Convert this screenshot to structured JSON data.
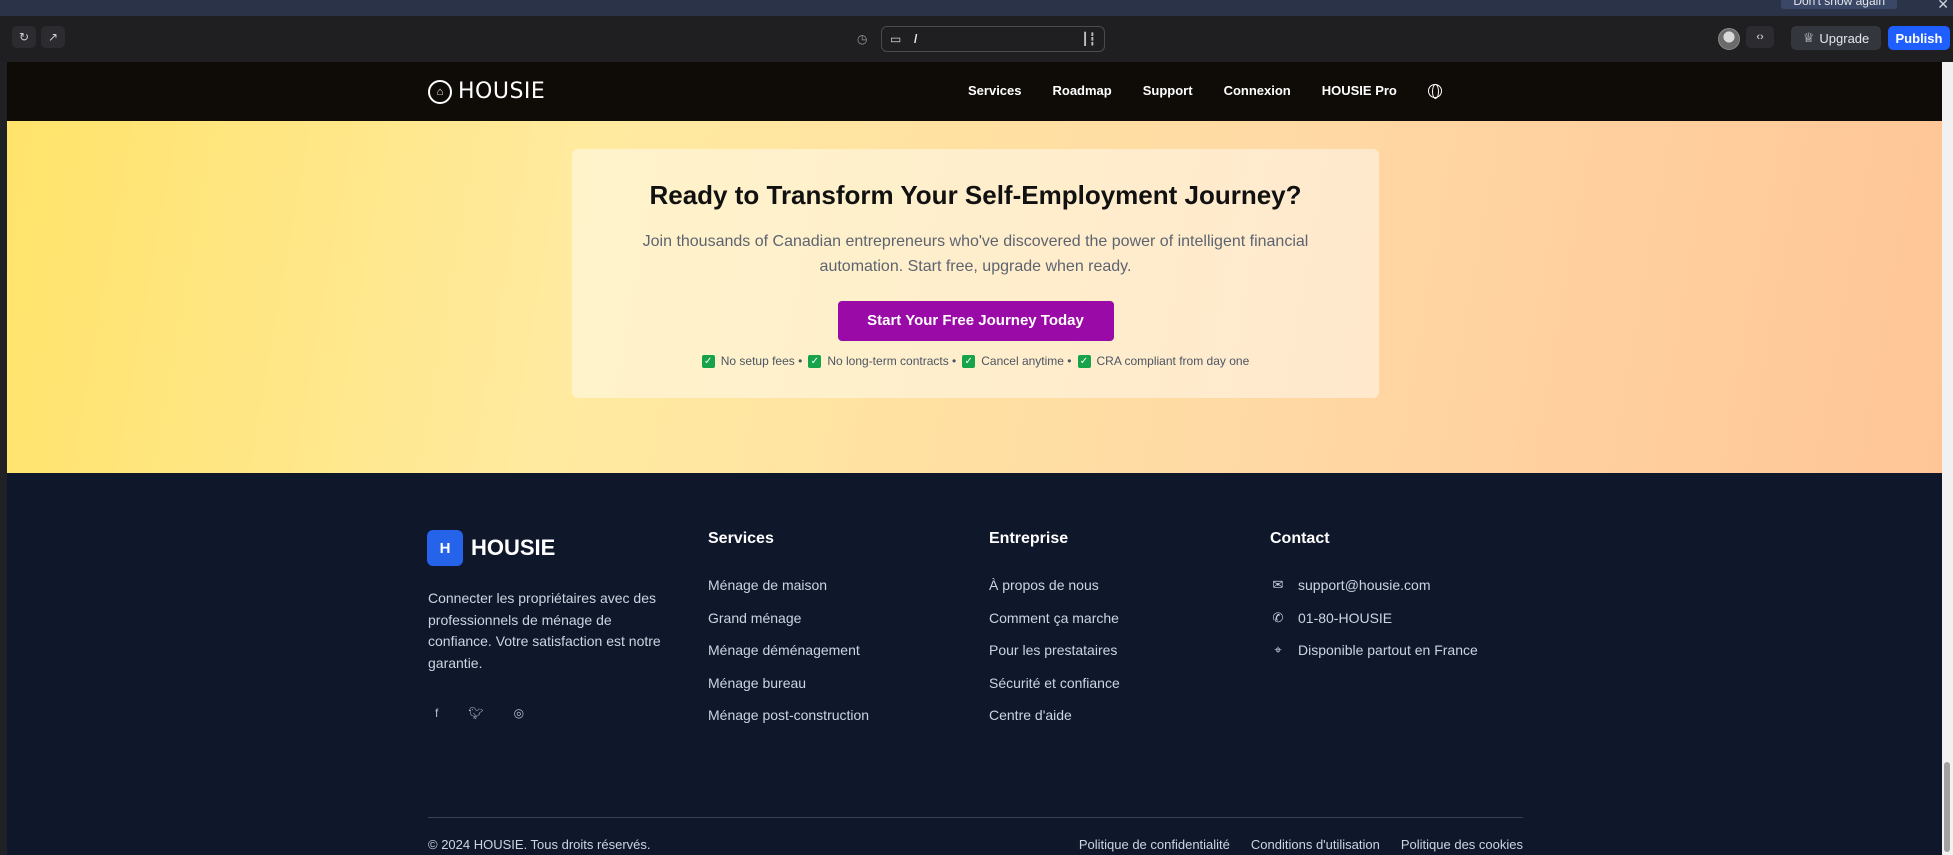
{
  "browser": {
    "notice_button": "Don't show again",
    "url_path": "/",
    "upgrade_label": "Upgrade",
    "publish_label": "Publish"
  },
  "nav": {
    "logo_text": "HOUSIE",
    "links": [
      "Services",
      "Roadmap",
      "Support",
      "Connexion",
      "HOUSIE Pro"
    ]
  },
  "cta_section": {
    "title": "Ready to Transform Your Self-Employment Journey?",
    "subtitle": "Join thousands of Canadian entrepreneurs who've discovered the power of intelligent financial automation. Start free, upgrade when ready.",
    "button": "Start Your Free Journey Today",
    "checks": [
      "No setup fees •",
      "No long-term contracts •",
      "Cancel anytime •",
      "CRA compliant from day one"
    ]
  },
  "footer": {
    "badge": "H",
    "brand": "HOUSIE",
    "description": "Connecter les propriétaires avec des professionnels de ménage de confiance. Votre satisfaction est notre garantie.",
    "services": {
      "title": "Services",
      "items": [
        "Ménage de maison",
        "Grand ménage",
        "Ménage déménagement",
        "Ménage bureau",
        "Ménage post-construction"
      ]
    },
    "company": {
      "title": "Entreprise",
      "items": [
        "À propos de nous",
        "Comment ça marche",
        "Pour les prestataires",
        "Sécurité et confiance",
        "Centre d'aide"
      ]
    },
    "contact": {
      "title": "Contact",
      "email": "support@housie.com",
      "phone": "01-80-HOUSIE",
      "location": "Disponible partout en France"
    },
    "copyright": "© 2024 HOUSIE. Tous droits réservés.",
    "legal": [
      "Politique de confidentialité",
      "Conditions d'utilisation",
      "Politique des cookies"
    ]
  },
  "colors": {
    "cta_button": "#9a0aa6",
    "publish": "#1f5eff",
    "footer_bg": "#0f172a",
    "check_green": "#16a34a"
  }
}
